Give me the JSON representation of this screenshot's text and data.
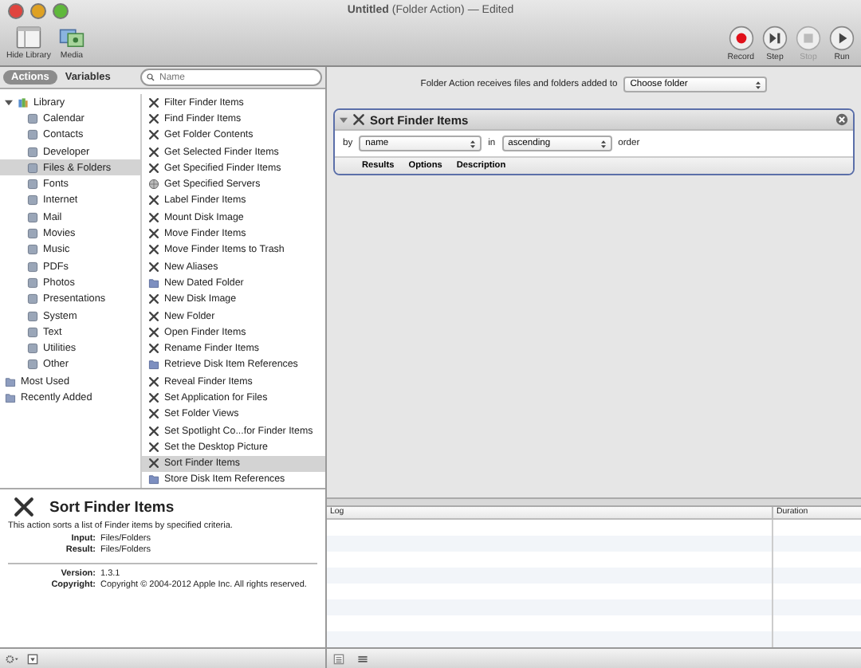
{
  "window": {
    "title": "**Untitled** (Folder Action) — Edited"
  },
  "toolbar": {
    "left": [
      {
        "label": "Hide Library",
        "kind": "library"
      },
      {
        "label": "Media",
        "kind": "media"
      }
    ],
    "right": [
      {
        "label": "Record",
        "kind": "record",
        "disabled": false
      },
      {
        "label": "Step",
        "kind": "step",
        "disabled": false
      },
      {
        "label": "Stop",
        "kind": "stop",
        "disabled": true
      },
      {
        "label": "Run",
        "kind": "run",
        "disabled": false
      }
    ]
  },
  "library_tabs": [
    {
      "label": "Actions",
      "selected": true
    },
    {
      "label": "Variables",
      "selected": false
    }
  ],
  "search": {
    "placeholder": "Name"
  },
  "library": [
    {
      "label": "Library",
      "expanded": true,
      "selected": false,
      "children": [
        {
          "label": "Calendar",
          "selected": false
        },
        {
          "label": "Contacts",
          "selected": false
        },
        {
          "label": "Developer",
          "selected": false
        },
        {
          "label": "Files & Folders",
          "selected": true
        },
        {
          "label": "Fonts",
          "selected": false
        },
        {
          "label": "Internet",
          "selected": false
        },
        {
          "label": "Mail",
          "selected": false
        },
        {
          "label": "Movies",
          "selected": false
        },
        {
          "label": "Music",
          "selected": false
        },
        {
          "label": "PDFs",
          "selected": false
        },
        {
          "label": "Photos",
          "selected": false
        },
        {
          "label": "Presentations",
          "selected": false
        },
        {
          "label": "System",
          "selected": false
        },
        {
          "label": "Text",
          "selected": false
        },
        {
          "label": "Utilities",
          "selected": false
        },
        {
          "label": "Other",
          "selected": false
        }
      ]
    },
    {
      "label": "Most Used",
      "selected": false
    },
    {
      "label": "Recently Added",
      "selected": false
    }
  ],
  "actions": [
    {
      "label": "Filter Finder Items",
      "kind": "tool",
      "selected": false
    },
    {
      "label": "Find Finder Items",
      "kind": "tool",
      "selected": false
    },
    {
      "label": "Get Folder Contents",
      "kind": "tool",
      "selected": false
    },
    {
      "label": "Get Selected Finder Items",
      "kind": "tool",
      "selected": false
    },
    {
      "label": "Get Specified Finder Items",
      "kind": "tool",
      "selected": false
    },
    {
      "label": "Get Specified Servers",
      "kind": "server",
      "selected": false
    },
    {
      "label": "Label Finder Items",
      "kind": "tool",
      "selected": false
    },
    {
      "label": "Mount Disk Image",
      "kind": "tool",
      "selected": false
    },
    {
      "label": "Move Finder Items",
      "kind": "tool",
      "selected": false
    },
    {
      "label": "Move Finder Items to Trash",
      "kind": "tool",
      "selected": false
    },
    {
      "label": "New Aliases",
      "kind": "tool",
      "selected": false
    },
    {
      "label": "New Dated Folder",
      "kind": "folder",
      "selected": false
    },
    {
      "label": "New Disk Image",
      "kind": "tool",
      "selected": false
    },
    {
      "label": "New Folder",
      "kind": "tool",
      "selected": false
    },
    {
      "label": "Open Finder Items",
      "kind": "tool",
      "selected": false
    },
    {
      "label": "Rename Finder Items",
      "kind": "tool",
      "selected": false
    },
    {
      "label": "Retrieve Disk Item References",
      "kind": "folder",
      "selected": false
    },
    {
      "label": "Reveal Finder Items",
      "kind": "tool",
      "selected": false
    },
    {
      "label": "Set Application for Files",
      "kind": "tool",
      "selected": false
    },
    {
      "label": "Set Folder Views",
      "kind": "tool",
      "selected": false
    },
    {
      "label": "Set Spotlight Co...for Finder Items",
      "kind": "tool",
      "selected": false
    },
    {
      "label": "Set the Desktop Picture",
      "kind": "tool",
      "selected": false
    },
    {
      "label": "Sort Finder Items",
      "kind": "tool",
      "selected": true
    },
    {
      "label": "Store Disk Item References",
      "kind": "folder",
      "selected": false
    }
  ],
  "description": {
    "title": "Sort Finder Items",
    "text": "This action sorts a list of Finder items by specified criteria.",
    "fields": [
      {
        "label": "Input:",
        "value": "Files/Folders"
      },
      {
        "label": "Result:",
        "value": "Files/Folders"
      }
    ],
    "meta": [
      {
        "label": "Version:",
        "value": "1.3.1"
      },
      {
        "label": "Copyright:",
        "value": "Copyright © 2004-2012 Apple Inc.  All rights reserved."
      }
    ]
  },
  "workflow": {
    "receives_label": "Folder Action receives files and folders added to",
    "folder_select": "Choose folder",
    "action": {
      "title": "Sort Finder Items",
      "expanded": true,
      "by_label": "by",
      "by_value": "name",
      "in_label": "in",
      "order_value": "ascending",
      "order_label": "order",
      "tabs": [
        "Results",
        "Options",
        "Description"
      ]
    }
  },
  "log": {
    "columns": [
      "Log",
      "Duration"
    ]
  }
}
